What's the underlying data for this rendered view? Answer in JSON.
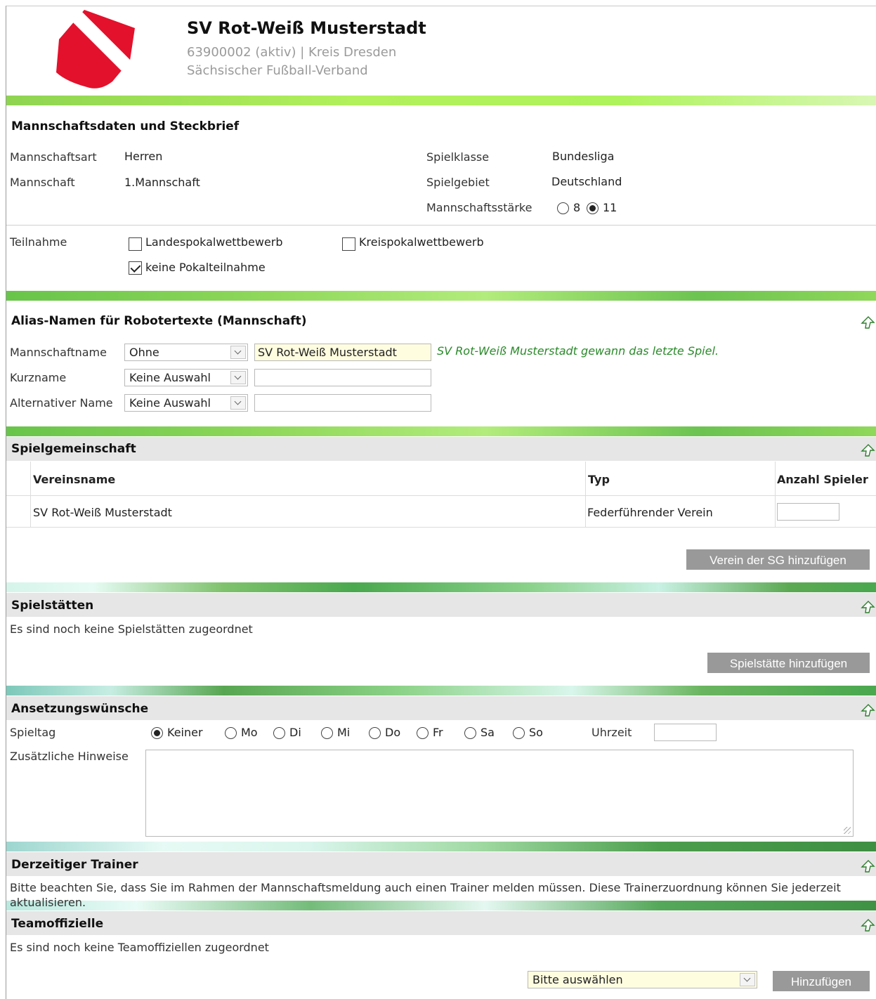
{
  "header": {
    "club_name": "SV Rot-Weiß Musterstadt",
    "club_id_line": "63900002 (aktiv) | Kreis Dresden",
    "association": "Sächsischer Fußball-Verband",
    "logo_colors": [
      "#e3112b",
      "#ffffff"
    ]
  },
  "team_data": {
    "title": "Mannschaftsdaten und Steckbrief",
    "type_label": "Mannschaftsart",
    "type_value": "Herren",
    "team_label": "Mannschaft",
    "team_value": "1.Mannschaft",
    "class_label": "Spielklasse",
    "class_value": "Bundesliga",
    "area_label": "Spielgebiet",
    "area_value": "Deutschland",
    "strength_label": "Mannschaftsstärke",
    "strength_options": [
      "8",
      "11"
    ],
    "strength_selected": "11"
  },
  "participation": {
    "label": "Teilnahme",
    "options": [
      {
        "label": "Landespokalwettbewerb",
        "checked": false
      },
      {
        "label": "Kreispokalwettbewerb",
        "checked": false
      },
      {
        "label": "keine Pokalteilnahme",
        "checked": true
      }
    ]
  },
  "alias": {
    "title": "Alias-Namen für Robotertexte (Mannschaft)",
    "rows": [
      {
        "label": "Mannschaftname",
        "select": "Ohne",
        "input": "SV Rot-Weiß Musterstadt"
      },
      {
        "label": "Kurzname",
        "select": "Keine Auswahl",
        "input": ""
      },
      {
        "label": "Alternativer Name",
        "select": "Keine Auswahl",
        "input": ""
      }
    ],
    "preview": "SV Rot-Weiß Musterstadt gewann das letzte Spiel."
  },
  "sg": {
    "title": "Spielgemeinschaft",
    "columns": [
      "Vereinsname",
      "Typ",
      "Anzahl Spieler"
    ],
    "rows": [
      {
        "name": "SV Rot-Weiß Musterstadt",
        "type": "Federführender Verein",
        "count": ""
      }
    ],
    "add_button": "Verein der SG hinzufügen"
  },
  "venues": {
    "title": "Spielstätten",
    "empty": "Es sind noch keine Spielstätten zugeordnet",
    "add_button": "Spielstätte hinzufügen"
  },
  "schedule": {
    "title": "Ansetzungswünsche",
    "day_label": "Spieltag",
    "days": [
      "Keiner",
      "Mo",
      "Di",
      "Mi",
      "Do",
      "Fr",
      "Sa",
      "So"
    ],
    "selected_day": "Keiner",
    "time_label": "Uhrzeit",
    "time_value": "",
    "notes_label": "Zusätzliche Hinweise",
    "notes_value": ""
  },
  "trainer": {
    "title": "Derzeitiger Trainer",
    "text": "Bitte beachten Sie, dass Sie im Rahmen der Mannschaftsmeldung auch einen Trainer melden müssen. Diese Trainerzuordnung können Sie jederzeit aktualisieren."
  },
  "officials": {
    "title": "Teamoffizielle",
    "empty": "Es sind noch keine Teamoffiziellen zugeordnet",
    "select": "Bitte auswählen",
    "add_button": "Hinzufügen"
  }
}
